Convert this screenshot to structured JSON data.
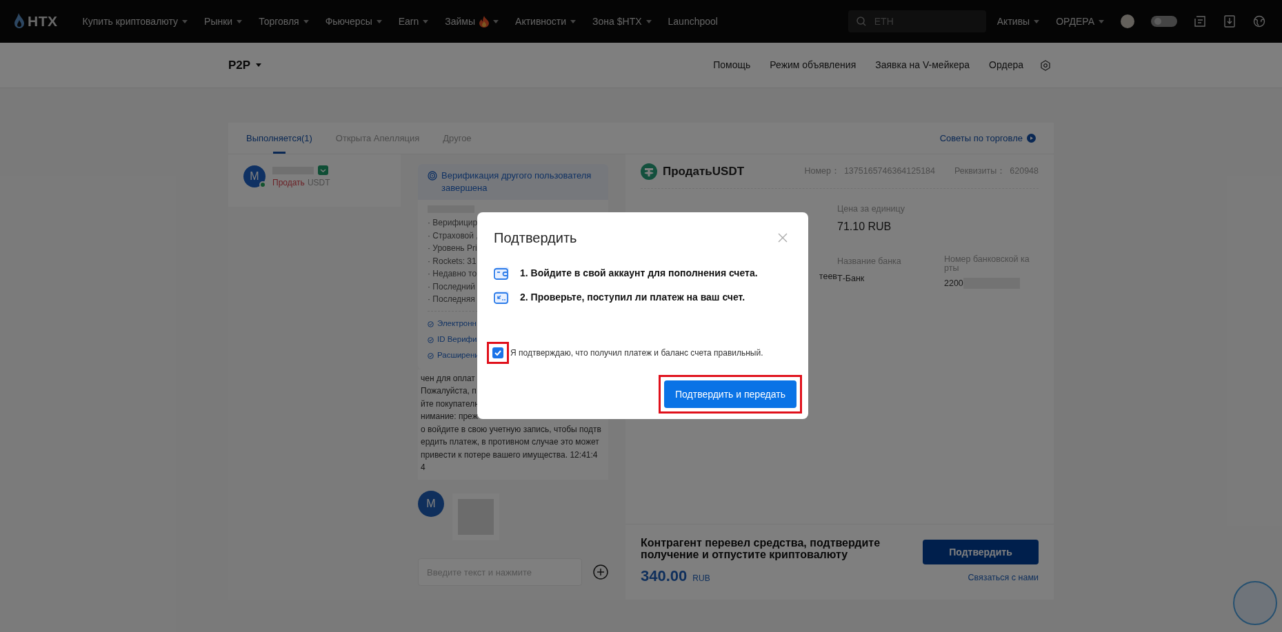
{
  "nav": {
    "logo": "HTX",
    "menu": [
      {
        "label": "Купить криптовалюту",
        "dropdown": true,
        "hot": false
      },
      {
        "label": "Рынки",
        "dropdown": true,
        "hot": false
      },
      {
        "label": "Торговля",
        "dropdown": true,
        "hot": false
      },
      {
        "label": "Фьючерсы",
        "dropdown": true,
        "hot": false
      },
      {
        "label": "Earn",
        "dropdown": true,
        "hot": false
      },
      {
        "label": "Займы",
        "dropdown": true,
        "hot": true
      },
      {
        "label": "Активности",
        "dropdown": true,
        "hot": false
      },
      {
        "label": "Зона $HTX",
        "dropdown": true,
        "hot": false
      },
      {
        "label": "Launchpool",
        "dropdown": false,
        "hot": false
      }
    ],
    "search": {
      "placeholder": "ETH"
    },
    "right_menu": [
      {
        "label": "Активы",
        "dropdown": true
      },
      {
        "label": "ОРДЕРА",
        "dropdown": true
      }
    ]
  },
  "subheader": {
    "title": "P2P",
    "links": [
      "Помощь",
      "Режим объявления",
      "Заявка на V-мейкера",
      "Ордера"
    ]
  },
  "tabs": [
    {
      "label": "Выполняется(1)",
      "selected": true
    },
    {
      "label": "Открыта Апелляция",
      "selected": false
    },
    {
      "label": "Другое",
      "selected": false
    }
  ],
  "tips_link": "Советы по торговле",
  "order_list": [
    {
      "avatar": "M",
      "online": true,
      "action": "Продать",
      "asset": "USDT",
      "selected": true
    }
  ],
  "chat": {
    "verification_title": "Верификация другого пользователя завершена",
    "details": [
      "· Верифицир",
      "· Страховой ,",
      "· Уровень Pri",
      "· Rockets: 31",
      "· Недавно то",
      "· Последний",
      "· Последняя"
    ],
    "checks": [
      "Электронн",
      "ID Верифи",
      "Расширени"
    ],
    "message_lines": [
      "чен для оплат",
      "Пожалуйста, п",
      "йте покупателн",
      "нимание: преж",
      "о войдите в свою учетную запись, чтобы подтв",
      "ердить платеж, в противном случае это может",
      "привести к потере вашего имущества. 12:41:4",
      "4"
    ],
    "avatar": "M",
    "input_placeholder": "Введите текст и нажмите"
  },
  "order": {
    "title": "ПродатьUSDT",
    "number_label": "Номер：",
    "number": "1375165746364125184",
    "details_label": "Реквизиты：",
    "details": "620948",
    "price_label": "Цена за единицу",
    "price": "71.10 RUB",
    "column_2_value": "теев",
    "bank_label": "Название банка",
    "bank": "Т-Банк",
    "card_label": "Номер банковской карты",
    "card": "2200"
  },
  "action_bar": {
    "message": "Контрагент перевел средства, подтвердите получение и отпустите криптовалюту",
    "amount": "340.00",
    "currency": "RUB",
    "button": "Подтвердить",
    "contact_link": "Связаться с нами"
  },
  "modal": {
    "title": "Подтвердить",
    "steps": [
      {
        "kind": "wallet",
        "text": "1. Войдите в свой аккаунт для пополнения счета."
      },
      {
        "kind": "receive",
        "text": "2. Проверьте, поступил ли платеж на ваш счет."
      }
    ],
    "agree": {
      "label": "Я подтверждаю, что получил платеж и баланс счета правильный.",
      "checked": true,
      "highlighted": true
    },
    "button": {
      "label": "Подтвердить и передать",
      "highlighted": true
    }
  }
}
